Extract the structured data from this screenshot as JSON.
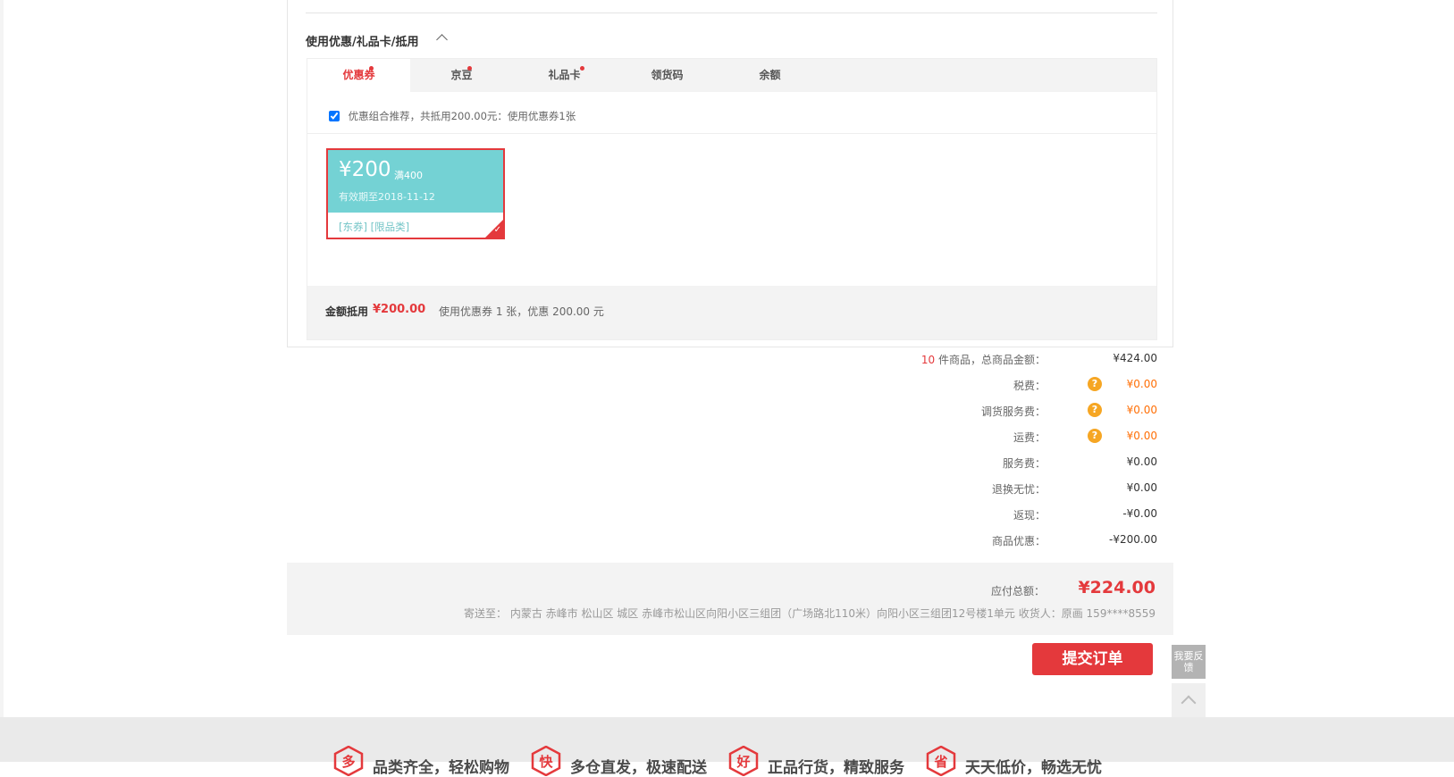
{
  "section": {
    "title": "使用优惠/礼品卡/抵用"
  },
  "tabs": [
    {
      "label": "优惠券",
      "active": true,
      "dot": true
    },
    {
      "label": "京豆",
      "active": false,
      "dot": true
    },
    {
      "label": "礼品卡",
      "active": false,
      "dot": true
    },
    {
      "label": "领货码",
      "active": false,
      "dot": false
    },
    {
      "label": "余额",
      "active": false,
      "dot": false
    }
  ],
  "recommend": {
    "checked": true,
    "text": "优惠组合推荐，共抵用200.00元：使用优惠券1张"
  },
  "coupon": {
    "amount": "¥200",
    "condition": "满400",
    "validity": "有效期至2018-11-12",
    "tags": "[东券]  [限品类]",
    "selected": true
  },
  "discount_summary": {
    "label": "金额抵用",
    "amount": "¥200.00",
    "description": "使用优惠券 1 张，优惠 200.00 元"
  },
  "fees": {
    "items_count": "10",
    "items_label": " 件商品，总商品金额：",
    "items_total": "¥424.00",
    "rows": [
      {
        "label": "税费：",
        "value": "¥0.00",
        "has_help": true
      },
      {
        "label": "调货服务费：",
        "value": "¥0.00",
        "has_help": true
      },
      {
        "label": "运费：",
        "value": "¥0.00",
        "has_help": true
      },
      {
        "label": "服务费：",
        "value": "¥0.00",
        "has_help": false
      },
      {
        "label": "退换无忧：",
        "value": "¥0.00",
        "has_help": false
      },
      {
        "label": "返现：",
        "value": "-¥0.00",
        "has_help": false
      },
      {
        "label": "商品优惠：",
        "value": "-¥200.00",
        "has_help": false
      }
    ]
  },
  "total": {
    "label": "应付总额：",
    "amount": "¥224.00",
    "address": "寄送至： 内蒙古 赤峰市 松山区 城区 赤峰市松山区向阳小区三组团（广场路北110米）向阳小区三组团12号楼1单元      收货人：原画 159****8559"
  },
  "submit_label": "提交订单",
  "feedback_label": "我要反馈",
  "footer": {
    "promises": [
      {
        "icon": "多",
        "text": "品类齐全，轻松购物"
      },
      {
        "icon": "快",
        "text": "多仓直发，极速配送"
      },
      {
        "icon": "好",
        "text": "正品行货，精致服务"
      },
      {
        "icon": "省",
        "text": "天天低价，畅选无忧"
      }
    ]
  },
  "colors": {
    "accent": "#e4393c",
    "coupon": "#74d2d4",
    "help_icon": "#f6a623"
  }
}
